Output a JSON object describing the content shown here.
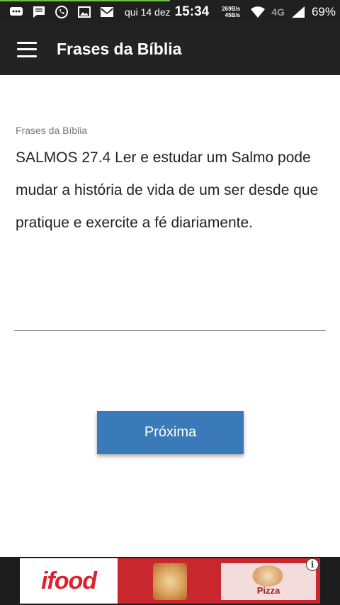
{
  "status_bar": {
    "date": "qui 14 dez",
    "time": "15:34",
    "net_up": "269B/s",
    "net_down": "45B/s",
    "network_type": "4G",
    "battery": "69%"
  },
  "app_bar": {
    "title": "Frases da Bíblia"
  },
  "content": {
    "label": "Frases da Bíblia",
    "verse": "SALMOS 27.4 Ler e estudar um Salmo pode mudar a história de vida de um ser desde que pratique e exercite a fé diariamente."
  },
  "actions": {
    "next_label": "Próxima"
  },
  "ad": {
    "brand": "ifood",
    "product_label": "Pizza",
    "info_symbol": "i",
    "colors": {
      "background": "#c8282d",
      "brand": "#e0202a"
    }
  },
  "colors": {
    "app_bar": "#232323",
    "button": "#3a7ab8"
  }
}
